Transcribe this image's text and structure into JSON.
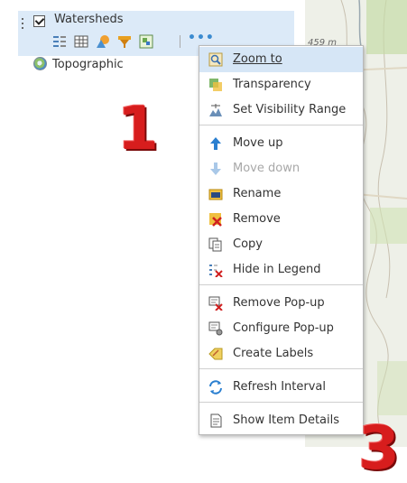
{
  "layers": {
    "watersheds": {
      "name": "Watersheds",
      "checked": true
    },
    "topographic": {
      "name": "Topographic"
    }
  },
  "toolbar": {
    "tools": [
      "show-table-icon",
      "table-icon",
      "change-style-icon",
      "filter-icon",
      "perform-analysis-icon"
    ],
    "more_label": "•••"
  },
  "map": {
    "scale_text": "459 m"
  },
  "menu": {
    "items": [
      {
        "label": "Zoom to",
        "icon": "zoom-to-icon",
        "state": "hover"
      },
      {
        "label": "Transparency",
        "icon": "transparency-icon"
      },
      {
        "label": "Set Visibility Range",
        "icon": "visibility-range-icon"
      },
      {
        "label": "Move up",
        "icon": "arrow-up-icon"
      },
      {
        "label": "Move down",
        "icon": "arrow-down-icon",
        "state": "disabled"
      },
      {
        "label": "Rename",
        "icon": "rename-icon"
      },
      {
        "label": "Remove",
        "icon": "remove-icon"
      },
      {
        "label": "Copy",
        "icon": "copy-icon"
      },
      {
        "label": "Hide in Legend",
        "icon": "hide-in-legend-icon"
      },
      {
        "label": "Remove Pop-up",
        "icon": "remove-popup-icon"
      },
      {
        "label": "Configure Pop-up",
        "icon": "configure-popup-icon"
      },
      {
        "label": "Create Labels",
        "icon": "create-labels-icon"
      },
      {
        "label": "Refresh Interval",
        "icon": "refresh-icon"
      },
      {
        "label": "Show Item Details",
        "icon": "item-details-icon"
      }
    ]
  },
  "annotations": {
    "first": "1",
    "second": "3"
  },
  "colors": {
    "accent": "#3b8bd0",
    "hover_bg": "#d6e6f6",
    "selected_row": "#dceaf8",
    "annotation": "#d71d1d"
  }
}
